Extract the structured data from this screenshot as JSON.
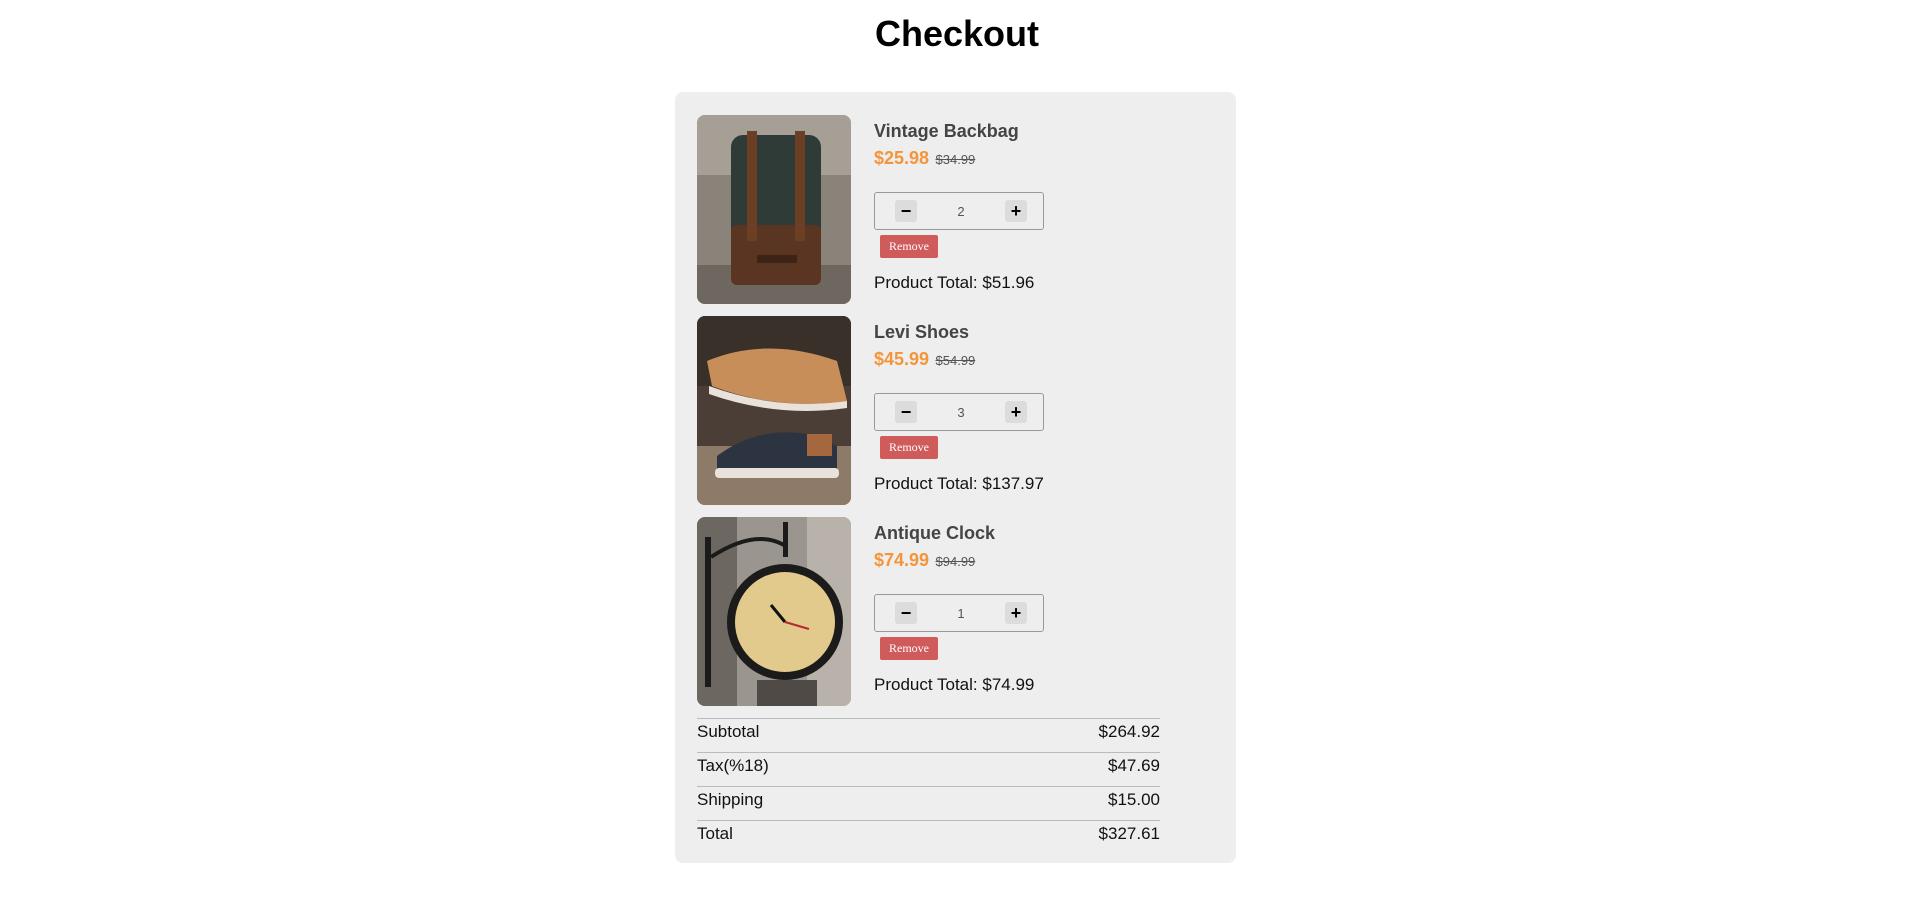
{
  "page": {
    "title": "Checkout"
  },
  "products": [
    {
      "name": "Vintage Backbag",
      "price": "$25.98",
      "old_price": "$34.99",
      "quantity": "2",
      "remove_label": "Remove",
      "total_label": "Product Total: $51.96",
      "image": "backpack-photo"
    },
    {
      "name": "Levi Shoes",
      "price": "$45.99",
      "old_price": "$54.99",
      "quantity": "3",
      "remove_label": "Remove",
      "total_label": "Product Total: $137.97",
      "image": "shoes-photo"
    },
    {
      "name": "Antique Clock",
      "price": "$74.99",
      "old_price": "$94.99",
      "quantity": "1",
      "remove_label": "Remove",
      "total_label": "Product Total: $74.99",
      "image": "clock-photo"
    }
  ],
  "stepper": {
    "minus": "−",
    "plus": "+"
  },
  "summary": {
    "subtotal_label": "Subtotal",
    "subtotal": "$264.92",
    "tax_label": "Tax(%18)",
    "tax": "$47.69",
    "shipping_label": "Shipping",
    "shipping": "$15.00",
    "total_label": "Total",
    "total": "$327.61"
  },
  "colors": {
    "accent": "#f4953b",
    "remove": "#cf5b5b",
    "card": "#eeeeee"
  }
}
